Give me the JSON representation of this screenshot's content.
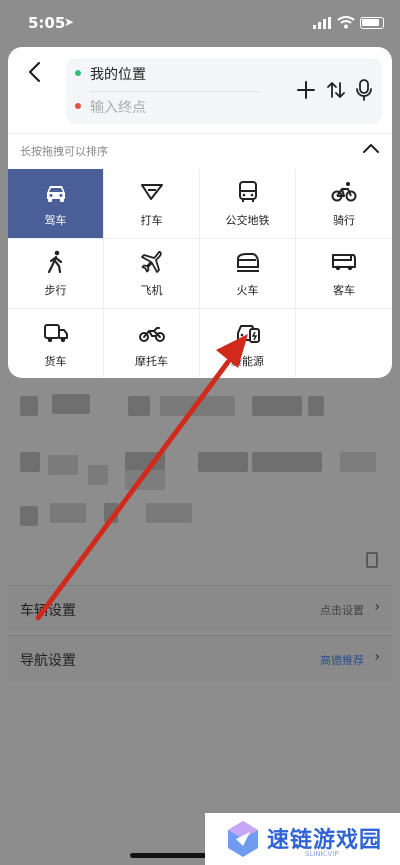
{
  "status_bar": {
    "time": "5:05"
  },
  "route": {
    "start": "我的位置",
    "end_placeholder": "输入终点"
  },
  "hint": "长按拖拽可以排序",
  "modes": [
    {
      "label": "驾车",
      "icon": "car-icon",
      "selected": true
    },
    {
      "label": "打车",
      "icon": "taxi-icon",
      "selected": false
    },
    {
      "label": "公交地铁",
      "icon": "bus-icon",
      "selected": false
    },
    {
      "label": "骑行",
      "icon": "bicycle-icon",
      "selected": false
    },
    {
      "label": "步行",
      "icon": "walk-icon",
      "selected": false
    },
    {
      "label": "飞机",
      "icon": "plane-icon",
      "selected": false
    },
    {
      "label": "火车",
      "icon": "train-icon",
      "selected": false
    },
    {
      "label": "客车",
      "icon": "coach-icon",
      "selected": false
    },
    {
      "label": "货车",
      "icon": "truck-icon",
      "selected": false
    },
    {
      "label": "摩托车",
      "icon": "motorcycle-icon",
      "selected": false
    },
    {
      "label": "新能源",
      "icon": "ev-car-icon",
      "selected": false
    }
  ],
  "settings": [
    {
      "label": "车辆设置",
      "value": "点击设置"
    },
    {
      "label": "导航设置",
      "value": "高德推荐"
    }
  ],
  "watermark": {
    "title": "速链游戏园",
    "subtitle": "SLINK.VIP"
  },
  "colors": {
    "selected_bg": "#4a5e97",
    "start_dot": "#2bbf7a",
    "end_dot": "#e0533d",
    "arrow": "#d12a1d",
    "watermark_blue": "#2f63d6"
  }
}
